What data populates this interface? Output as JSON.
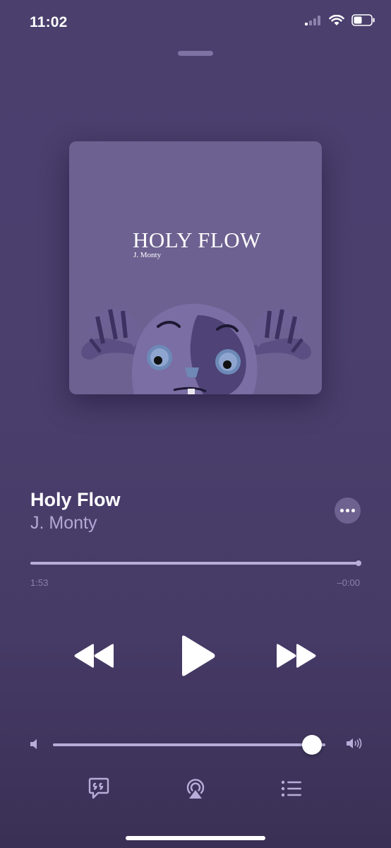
{
  "status_bar": {
    "time": "11:02"
  },
  "artwork": {
    "title": "HOLY FLOW",
    "artist": "J. Monty",
    "background_color": "#6c6190"
  },
  "track": {
    "title": "Holy Flow",
    "artist": "J. Monty"
  },
  "progress": {
    "elapsed": "1:53",
    "remaining": "–0:00",
    "fraction": 1.0
  },
  "volume": {
    "level": 0.95
  },
  "icons": {
    "more": "ellipsis-icon",
    "rewind": "rewind-icon",
    "play": "play-icon",
    "forward": "fast-forward-icon",
    "lyrics": "lyrics-quote-icon",
    "airplay": "airplay-icon",
    "queue": "queue-list-icon"
  },
  "colors": {
    "accent": "#b7add8",
    "background": "#4a3f6d"
  }
}
